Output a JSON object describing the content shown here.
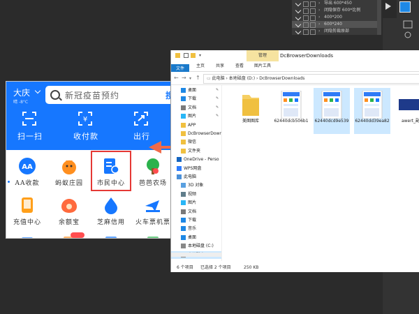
{
  "photoshop": {
    "layers": [
      {
        "label": "导出 600*450",
        "selected": false
      },
      {
        "label": "闭隐保存 600*比例",
        "selected": false
      },
      {
        "label": "400*200",
        "selected": false
      },
      {
        "label": "600*240",
        "selected": true
      },
      {
        "label": "闭隐剪裁原部",
        "selected": false
      }
    ],
    "accent_color": "#1e88e5"
  },
  "alipay": {
    "city": "大庆",
    "weather": "晴 -8°C",
    "search_placeholder": "新冠疫苗预约",
    "search_button": "搜",
    "top_actions": [
      {
        "label": "扫一扫",
        "icon": "scan-icon"
      },
      {
        "label": "收付款",
        "icon": "payment-code-icon"
      },
      {
        "label": "出行",
        "icon": "travel-icon"
      }
    ],
    "grid_items": [
      {
        "label": "AA收款",
        "icon": "aa-collection-icon",
        "color": "#1677ff"
      },
      {
        "label": "蚂蚁庄园",
        "icon": "ant-farm-chick-icon",
        "color": "#ff8f1f"
      },
      {
        "label": "市民中心",
        "icon": "citizen-center-icon",
        "color": "#1677ff"
      },
      {
        "label": "芭芭农场",
        "icon": "baba-farm-icon",
        "color": "#2bb24c"
      },
      {
        "label": "充值中心",
        "icon": "recharge-center-icon",
        "color": "#ff9f1a"
      },
      {
        "label": "余额宝",
        "icon": "yuebao-icon",
        "color": "#ff6a3d"
      },
      {
        "label": "芝麻信用",
        "icon": "sesame-credit-icon",
        "color": "#1677ff"
      },
      {
        "label": "火车票机票",
        "icon": "train-ticket-icon",
        "color": "#1677ff"
      }
    ],
    "highlighted_item": "市民中心",
    "primary_color": "#1677ff",
    "highlight_color": "#e53935"
  },
  "arrow_color": "#f06a4a",
  "explorer": {
    "manage_tab": "管理",
    "window_title": "DcBrowserDownloads",
    "ribbon_tabs": [
      "文件",
      "主页",
      "共享",
      "查看",
      "图片工具"
    ],
    "breadcrumb": "此电脑 › 本地磁盘 (D:) › DcBrowserDownloads",
    "nav_items": [
      {
        "label": "桌面",
        "icon": "desktop-icon",
        "pinned": true,
        "selected": false
      },
      {
        "label": "下载",
        "icon": "download-icon",
        "pinned": true,
        "selected": false
      },
      {
        "label": "文档",
        "icon": "documents-icon",
        "pinned": true,
        "selected": false
      },
      {
        "label": "图片",
        "icon": "pictures-icon",
        "pinned": true,
        "selected": false
      },
      {
        "label": "APP",
        "icon": "folder-icon",
        "pinned": false,
        "selected": false
      },
      {
        "label": "DcBrowserDownloads",
        "icon": "folder-icon",
        "pinned": false,
        "selected": false
      },
      {
        "label": "微信",
        "icon": "folder-icon",
        "pinned": false,
        "selected": false
      },
      {
        "label": "文件夹",
        "icon": "folder-icon",
        "pinned": false,
        "selected": false
      },
      {
        "label": "OneDrive - Perso",
        "icon": "onedrive-icon",
        "pinned": false,
        "selected": false
      },
      {
        "label": "WPS网盘",
        "icon": "wps-cloud-icon",
        "pinned": false,
        "selected": false
      },
      {
        "label": "此电脑",
        "icon": "this-pc-icon",
        "pinned": false,
        "selected": false
      },
      {
        "label": "3D 对象",
        "icon": "3d-objects-icon",
        "pinned": false,
        "selected": false
      },
      {
        "label": "视频",
        "icon": "videos-icon",
        "pinned": false,
        "selected": false
      },
      {
        "label": "图片",
        "icon": "pictures-icon",
        "pinned": false,
        "selected": false
      },
      {
        "label": "文档",
        "icon": "documents-icon",
        "pinned": false,
        "selected": false
      },
      {
        "label": "下载",
        "icon": "download-icon",
        "pinned": false,
        "selected": false
      },
      {
        "label": "音乐",
        "icon": "music-icon",
        "pinned": false,
        "selected": false
      },
      {
        "label": "桌面",
        "icon": "desktop-icon",
        "pinned": false,
        "selected": false
      },
      {
        "label": "本地磁盘 (C:)",
        "icon": "drive-icon",
        "pinned": false,
        "selected": false
      },
      {
        "label": "本地磁盘 (D:)",
        "icon": "drive-icon",
        "pinned": false,
        "selected": true
      }
    ],
    "files": [
      {
        "name": "美图图库",
        "type": "folder",
        "selected": false
      },
      {
        "name": "62440dcb506b1",
        "type": "image",
        "selected": false
      },
      {
        "name": "62440dcd9e539",
        "type": "image",
        "selected": true
      },
      {
        "name": "62440dd39ea82",
        "type": "image",
        "selected": true
      },
      {
        "name": "awert_副本",
        "type": "image",
        "selected": false
      }
    ],
    "status_count": "6 个项目",
    "status_selected": "已选择 2 个项目",
    "status_size": "250 KB",
    "selection_color": "#cce8ff",
    "file_tab_color": "#1979ca"
  }
}
